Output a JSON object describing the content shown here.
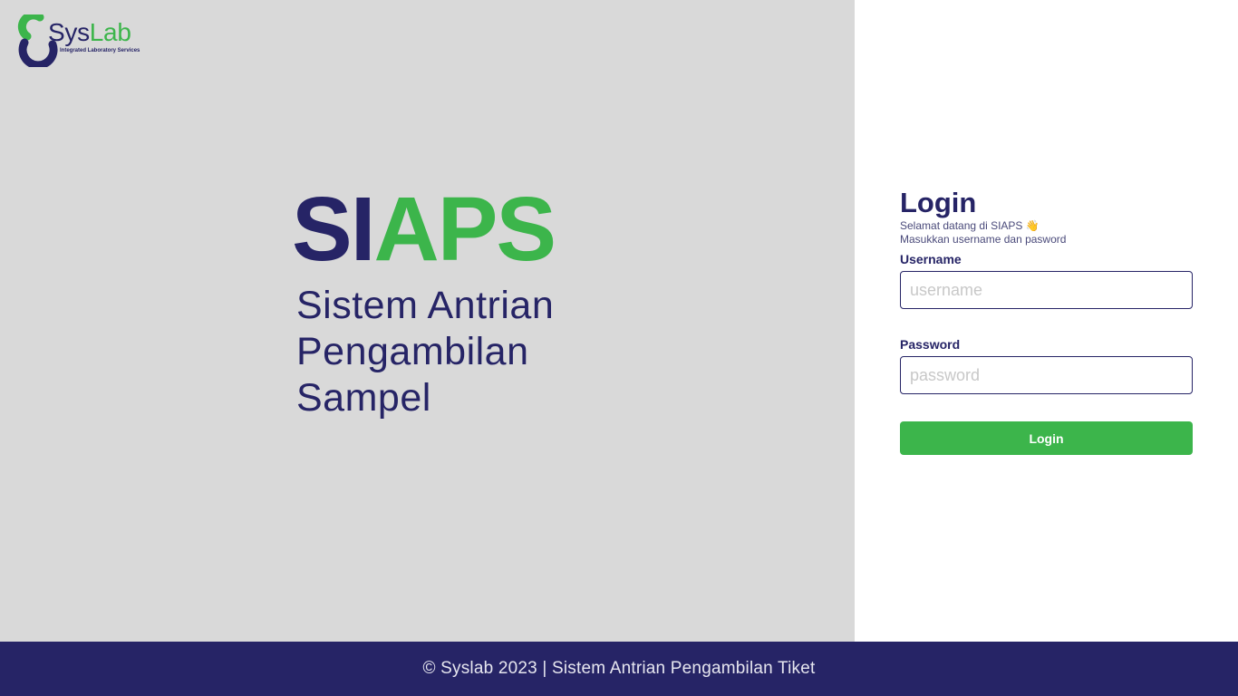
{
  "logo": {
    "word_part1": "Sys",
    "word_part2": "Lab",
    "tagline": "Integrated Laboratory Services"
  },
  "hero": {
    "brand_part1": "SI",
    "brand_part2": "APS",
    "subtitle_line1": "Sistem Antrian",
    "subtitle_line2": "Pengambilan",
    "subtitle_line3": "Sampel"
  },
  "login": {
    "title": "Login",
    "welcome": "Selamat datang di SIAPS 👋",
    "instructions": "Masukkan username dan pasword",
    "username_label": "Username",
    "username_placeholder": "username",
    "username_value": "",
    "password_label": "Password",
    "password_placeholder": "password",
    "password_value": "",
    "button_label": "Login"
  },
  "footer": {
    "text": "© Syslab 2023 | Sistem Antrian Pengambilan Tiket"
  },
  "colors": {
    "navy": "#262466",
    "green": "#3cb54b",
    "left_panel_bg": "#d9d9d9",
    "right_panel_bg": "#ffffff"
  }
}
